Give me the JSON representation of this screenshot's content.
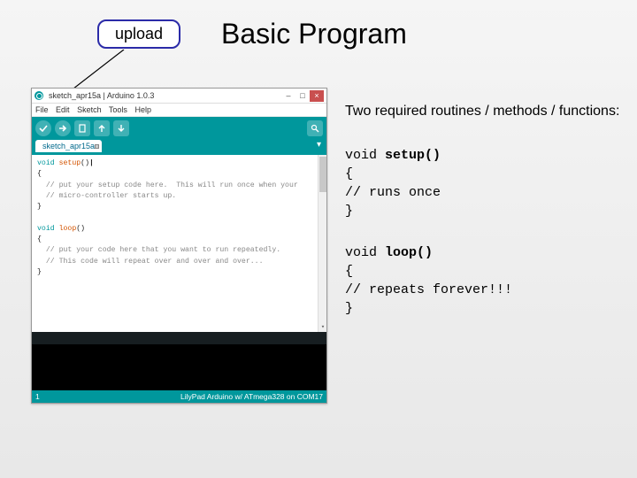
{
  "callout": {
    "label": "upload"
  },
  "title": "Basic Program",
  "right": {
    "intro": "Two required routines / methods / functions:",
    "setup": {
      "sig_kw": "void ",
      "sig_fn": "setup()",
      "l1": "{",
      "l2": "// runs once",
      "l3": "}"
    },
    "loop": {
      "sig_kw": "void ",
      "sig_fn": "loop()",
      "l1": "{",
      "l2": "// repeats forever!!!",
      "l3": "}"
    }
  },
  "ide": {
    "title": "sketch_apr15a | Arduino 1.0.3",
    "menu": {
      "file": "File",
      "edit": "Edit",
      "sketch": "Sketch",
      "tools": "Tools",
      "help": "Help"
    },
    "tab": "sketch_apr15a",
    "code": {
      "l1_kw": "void ",
      "l1_fn": "setup",
      "l1_rest": "()",
      "l2": "{",
      "l3": "  // put your setup code here.  This will run once when your",
      "l4": "  // micro-controller starts up.",
      "l5": "}",
      "l6": "",
      "l7_kw": "void ",
      "l7_fn": "loop",
      "l7_rest": "()",
      "l8": "{",
      "l9": "  // put your code here that you want to run repeatedly.",
      "l10": "  // This code will repeat over and over and over...",
      "l11": "}",
      "cursor": "|"
    },
    "status": {
      "line": "1",
      "board": "LilyPad Arduino w/ ATmega328 on COM17"
    }
  }
}
